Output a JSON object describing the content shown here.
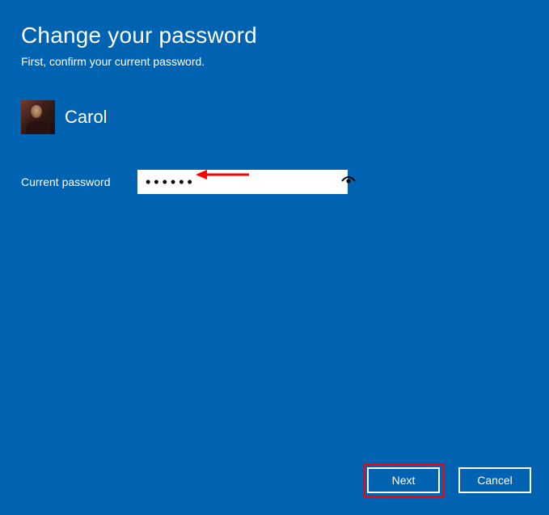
{
  "title": "Change your password",
  "subtitle": "First, confirm your current password.",
  "user": {
    "name": "Carol"
  },
  "field": {
    "label": "Current password",
    "value": "••••••"
  },
  "buttons": {
    "next": "Next",
    "cancel": "Cancel"
  }
}
